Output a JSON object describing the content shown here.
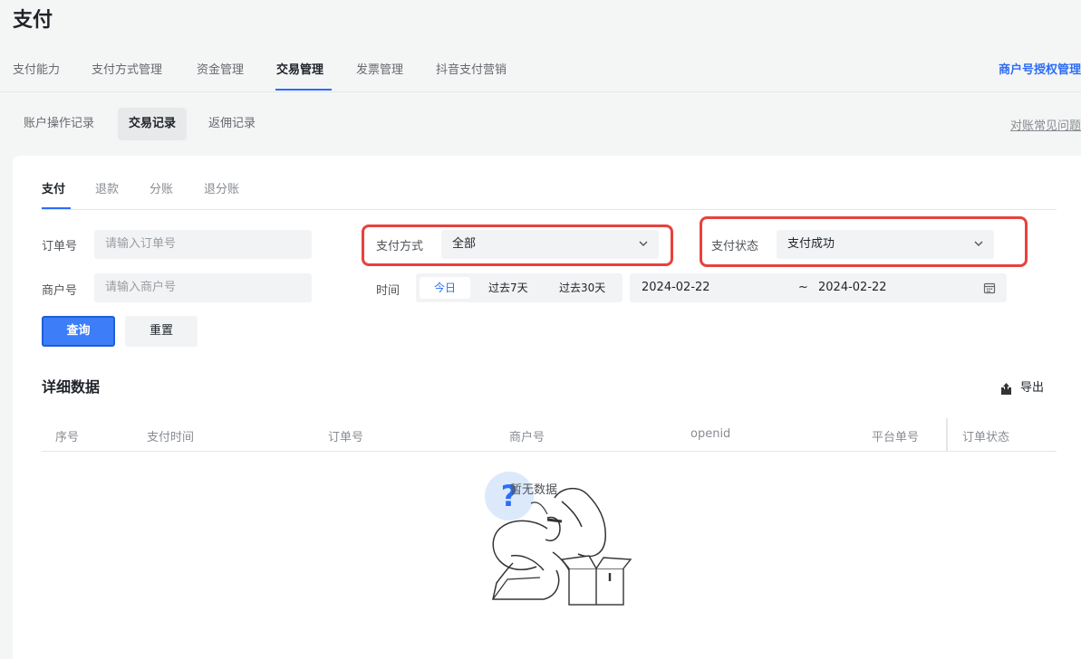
{
  "page": {
    "title": "支付"
  },
  "top_tabs": [
    "支付能力",
    "支付方式管理",
    "资金管理",
    "交易管理",
    "发票管理",
    "抖音支付营销"
  ],
  "merchant_auth_link": "商户号授权管理",
  "sub_tabs": [
    "账户操作记录",
    "交易记录",
    "返佣记录"
  ],
  "faq_link": "对账常见问题",
  "inner_tabs": [
    "支付",
    "退款",
    "分账",
    "退分账"
  ],
  "filters": {
    "order_label": "订单号",
    "order_placeholder": "请输入订单号",
    "merchant_label": "商户号",
    "merchant_placeholder": "请输入商户号",
    "pay_method_label": "支付方式",
    "pay_method_value": "全部",
    "pay_status_label": "支付状态",
    "pay_status_value": "支付成功",
    "time_label": "时间",
    "time_options": [
      "今日",
      "过去7天",
      "过去30天"
    ],
    "date_start": "2024-02-22",
    "date_sep": "~",
    "date_end": "2024-02-22"
  },
  "buttons": {
    "query": "查询",
    "reset": "重置",
    "export": "导出"
  },
  "table": {
    "title": "详细数据",
    "columns": [
      "序号",
      "支付时间",
      "订单号",
      "商户号",
      "openid",
      "平台单号",
      "订单状态"
    ],
    "empty_text": "暂无数据"
  },
  "colors": {
    "accent": "#2d6df6",
    "highlight": "#e8413d"
  }
}
